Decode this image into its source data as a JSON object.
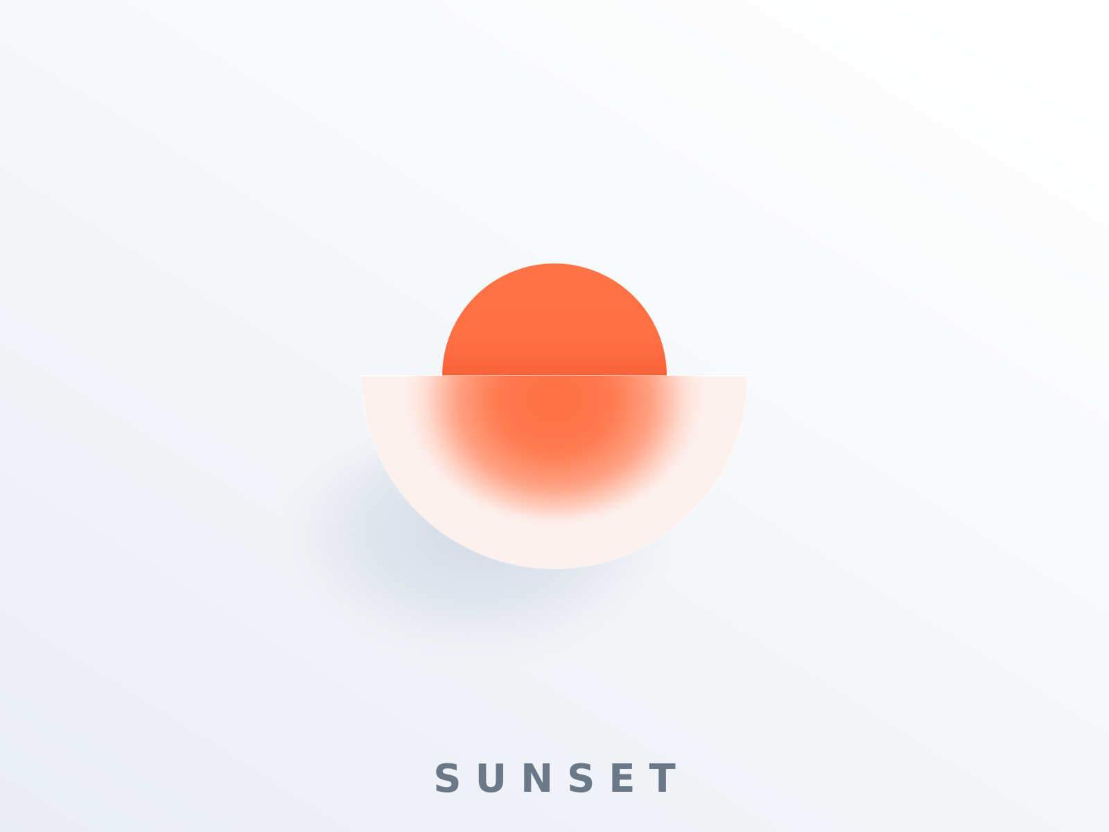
{
  "title": "SUNSET",
  "colors": {
    "sun": "#ff7246",
    "bowl": "#fdf1ee",
    "title": "#6a7887",
    "background": "#f2f5f8"
  },
  "icons": {
    "artwork": "sunset-icon"
  }
}
